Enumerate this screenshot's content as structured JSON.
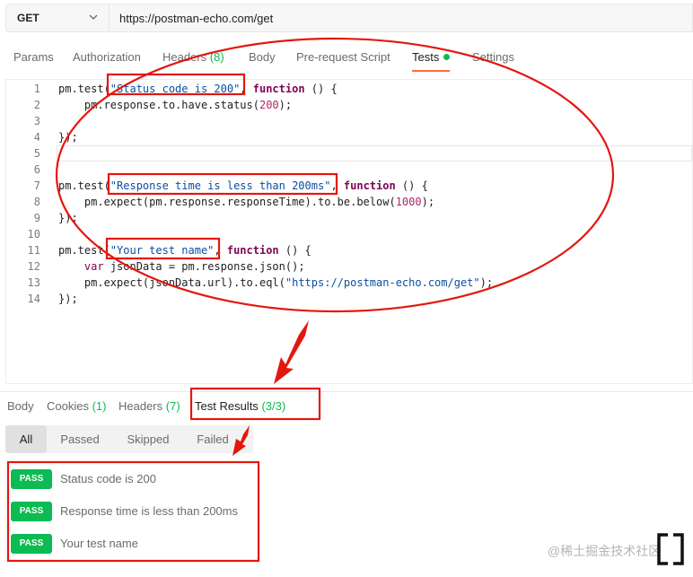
{
  "request": {
    "method": "GET",
    "url": "https://postman-echo.com/get"
  },
  "request_tabs": [
    {
      "label": "Params",
      "count": ""
    },
    {
      "label": "Authorization",
      "count": ""
    },
    {
      "label": "Headers",
      "count": "(8)"
    },
    {
      "label": "Body",
      "count": ""
    },
    {
      "label": "Pre-request Script",
      "count": ""
    },
    {
      "label": "Tests",
      "count": "",
      "active": true
    },
    {
      "label": "Settings",
      "count": ""
    }
  ],
  "editor": {
    "line_numbers": [
      "1",
      "2",
      "3",
      "4",
      "5",
      "6",
      "7",
      "8",
      "9",
      "10",
      "11",
      "12",
      "13",
      "14"
    ],
    "test_names": [
      "\"Status code is 200\"",
      "\"Response time is less than 200ms\"",
      "\"Your test name\""
    ],
    "kw_function": "function",
    "kw_var": "var",
    "num_200": "200",
    "num_1000": "1000",
    "url_string": "\"https://postman-echo.com/get\""
  },
  "response_tabs": [
    {
      "label": "Body",
      "count": ""
    },
    {
      "label": "Cookies",
      "count": "(1)"
    },
    {
      "label": "Headers",
      "count": "(7)"
    },
    {
      "label": "Test Results",
      "count": "(3/3)",
      "active": true
    }
  ],
  "filters": [
    "All",
    "Passed",
    "Skipped",
    "Failed"
  ],
  "results": [
    {
      "status": "PASS",
      "name": "Status code is 200"
    },
    {
      "status": "PASS",
      "name": "Response time is less than 200ms"
    },
    {
      "status": "PASS",
      "name": "Your test name"
    }
  ],
  "watermark": "@稀土掘金技术社区",
  "colors": {
    "pass_green": "#0cbb52",
    "annotation_red": "#e3170d",
    "keyword": "#800555",
    "string": "#0a4fa3",
    "number": "#b0266a",
    "active_tab_underline": "#ff6c37"
  }
}
